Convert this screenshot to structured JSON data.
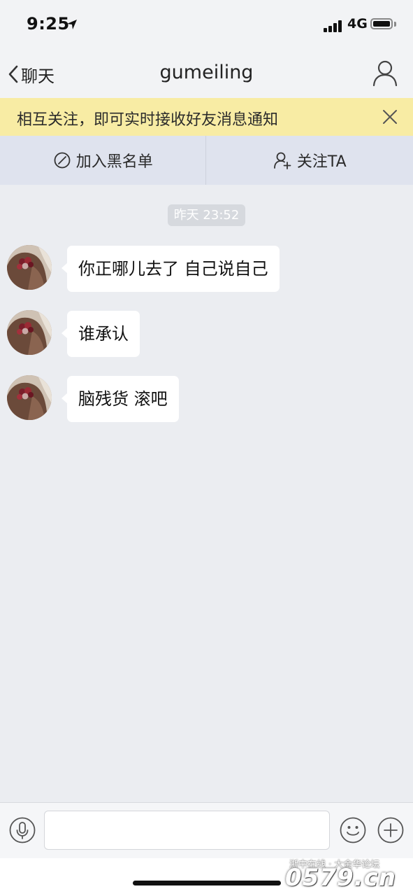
{
  "status_bar": {
    "time": "9:25",
    "network": "4G"
  },
  "nav": {
    "back_label": "聊天",
    "title": "gumeiling"
  },
  "notice": {
    "text": "相互关注，即可实时接收好友消息通知"
  },
  "actions": {
    "block_label": "加入黑名单",
    "follow_label": "关注TA"
  },
  "chat": {
    "timestamp": "昨天 23:52",
    "messages": [
      {
        "text": "你正哪儿去了 自己说自己"
      },
      {
        "text": "谁承认"
      },
      {
        "text": "脑残货 滚吧"
      }
    ]
  },
  "input": {
    "value": "",
    "placeholder": ""
  },
  "watermark": {
    "line1": "浙中在线 · 大金华论坛",
    "line2": "0579.cn"
  },
  "colors": {
    "notice_bg": "#f8eca4",
    "action_bar_bg": "#dfe3ee",
    "chat_bg": "#ebedf1"
  }
}
